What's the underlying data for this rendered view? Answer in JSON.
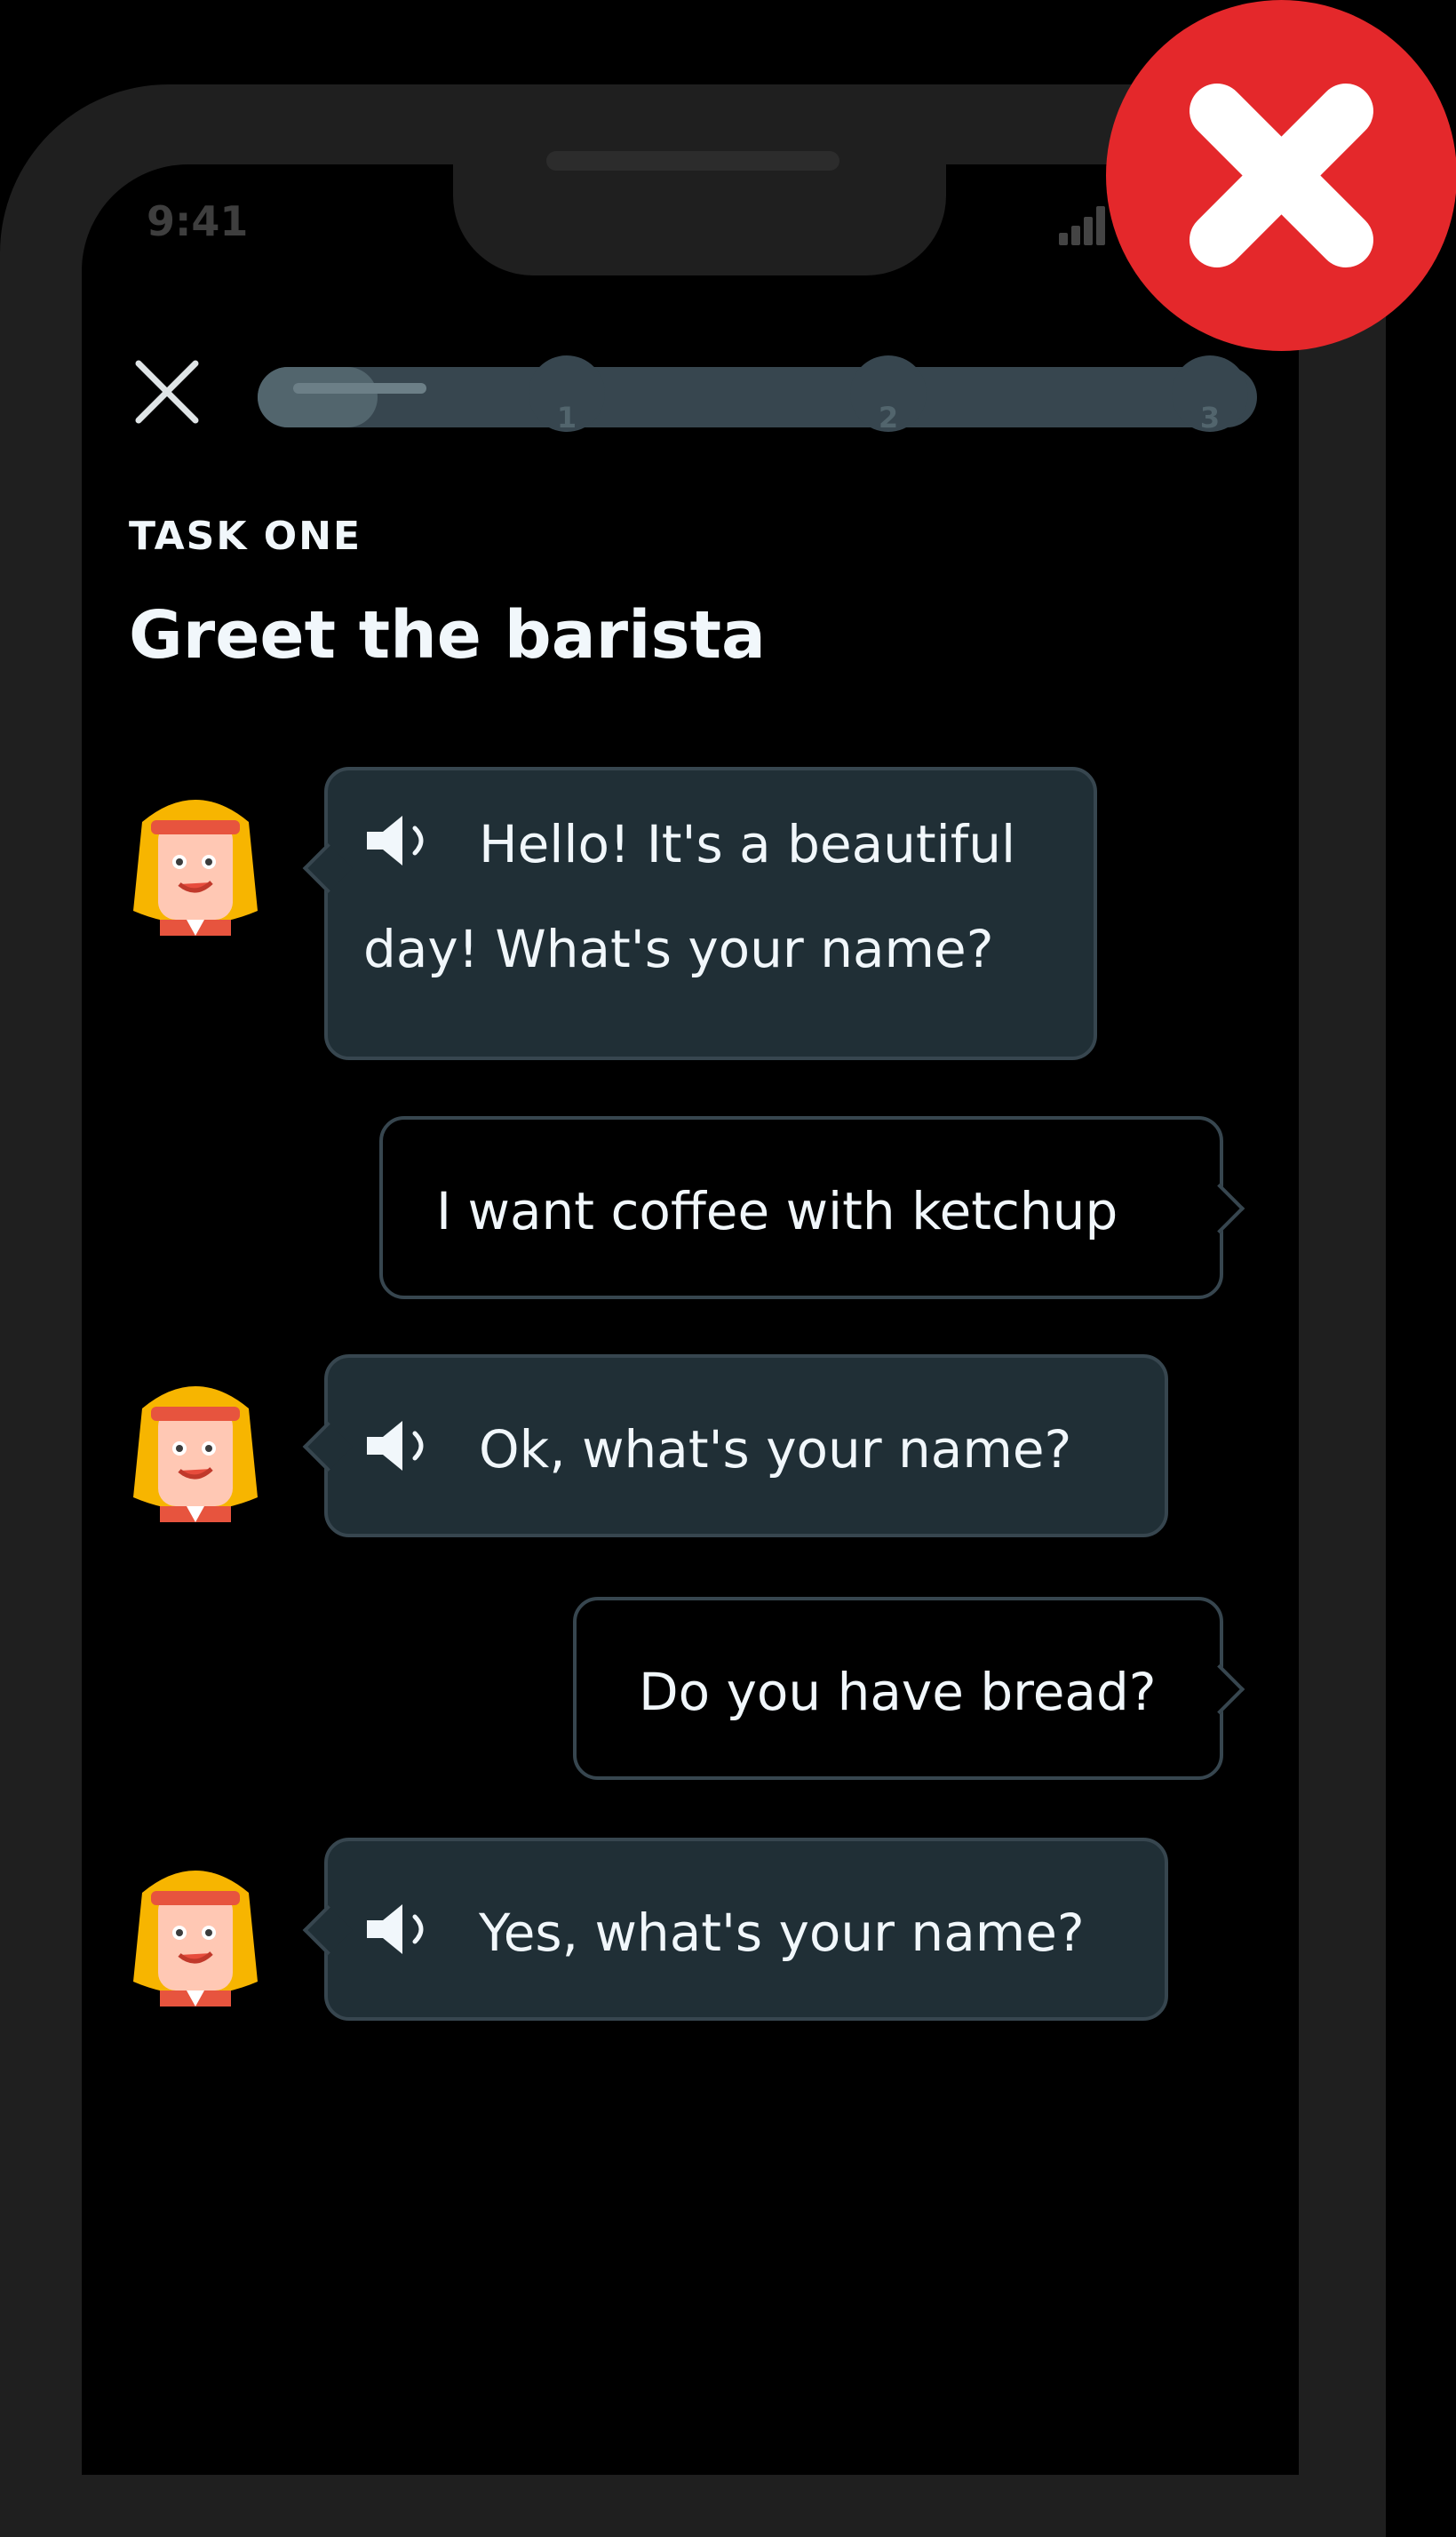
{
  "status_bar": {
    "time": "9:41"
  },
  "progress": {
    "fraction_complete": 0.12,
    "milestones": [
      "1",
      "2",
      "3"
    ]
  },
  "task": {
    "label": "TASK ONE",
    "title": "Greet the barista"
  },
  "messages": [
    {
      "from": "barista",
      "text_line1": "Hello! It's a beautiful",
      "text_line2": "day! What's your name?"
    },
    {
      "from": "user",
      "text": "I want coffee with ketchup"
    },
    {
      "from": "barista",
      "text": "Ok, what's your name?"
    },
    {
      "from": "user",
      "text": "Do you have bread?"
    },
    {
      "from": "barista",
      "text": "Yes, what's your name?"
    }
  ],
  "colors": {
    "background": "#000000",
    "bubble_bot": "#202f36",
    "bubble_border": "#37464f",
    "error_red": "#e4282b"
  },
  "icons": [
    "close-icon",
    "speaker-icon",
    "signal-icon",
    "error-x-icon"
  ]
}
